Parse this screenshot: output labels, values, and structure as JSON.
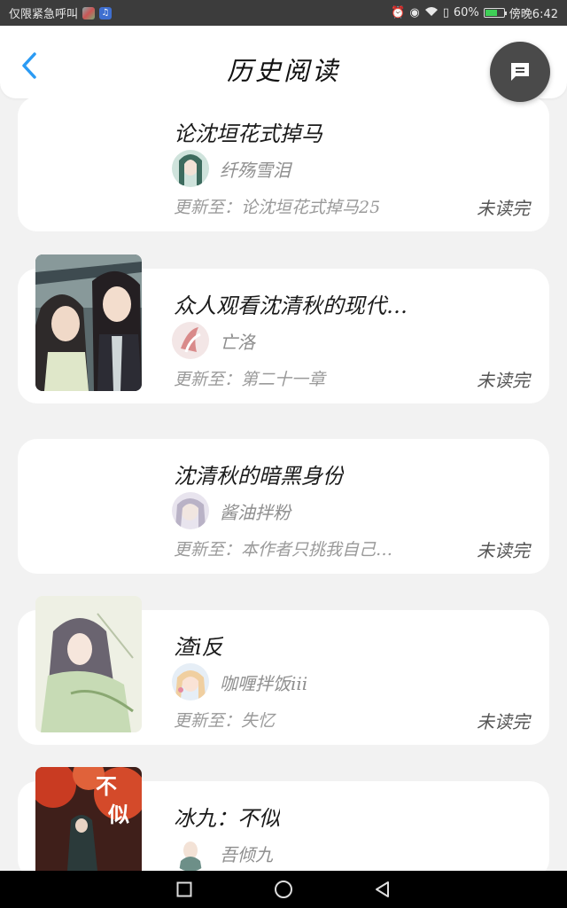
{
  "status_bar": {
    "left_text": "仅限紧急呼叫",
    "battery_text": "60%",
    "time_text": "傍晚6:42",
    "battery_level": 0.6
  },
  "header": {
    "title": "历史阅读",
    "back_icon": "chevron-left-icon",
    "fab_icon": "message-icon"
  },
  "colors": {
    "accent_blue": "#2b9bf4",
    "background": "#f2f2f2",
    "fab": "#4a4a4a",
    "battery_green": "#3fcf57"
  },
  "books": [
    {
      "title": "论沈垣花式掉马",
      "author": "纤殇雪泪",
      "update": "更新至：论沈垣花式掉马25",
      "status": "未读完",
      "has_cover": false
    },
    {
      "title": "众人观看沈清秋的现代…",
      "author": "亡洛",
      "update": "更新至：第二十一章",
      "status": "未读完",
      "has_cover": true
    },
    {
      "title": "沈清秋的暗黑身份",
      "author": "酱油拌粉",
      "update": "更新至：本作者只挑我自己…",
      "status": "未读完",
      "has_cover": false
    },
    {
      "title": "渣i反",
      "author": "咖喱拌饭iii",
      "update": "更新至：失忆",
      "status": "未读完",
      "has_cover": true
    },
    {
      "title": "冰九：不似",
      "author": "吾倾九",
      "update": "",
      "status": "",
      "has_cover": true,
      "cover_text": "不似"
    }
  ],
  "nav": {
    "recent_icon": "square-icon",
    "home_icon": "circle-icon",
    "back_icon": "triangle-back-icon"
  }
}
